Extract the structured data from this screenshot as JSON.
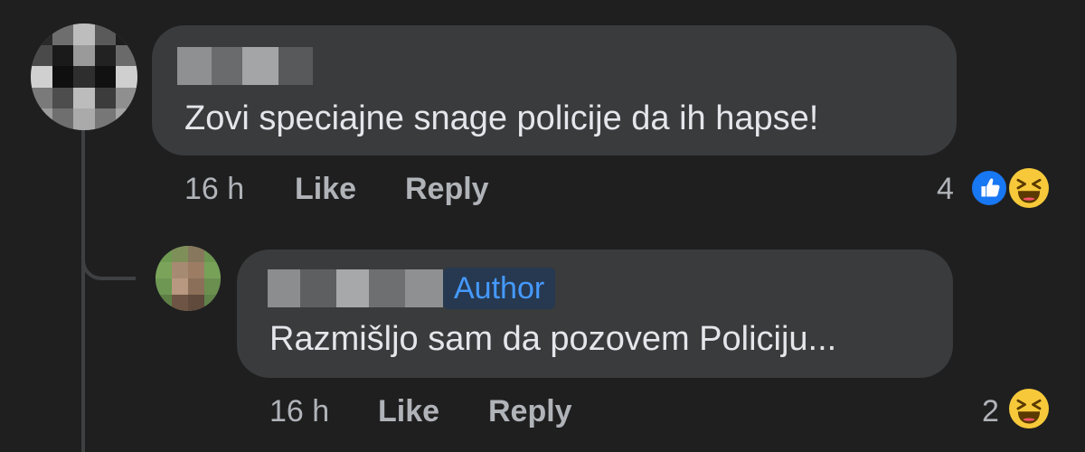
{
  "comments": [
    {
      "text": "Zovi speciajne snage policije da ih hapse!",
      "time": "16 h",
      "like_label": "Like",
      "reply_label": "Reply",
      "reaction_count": "4",
      "reactions": [
        "like-icon",
        "haha-icon"
      ]
    },
    {
      "badge": "Author",
      "text": "Razmišljo sam da pozovem Policiju...",
      "time": "16 h",
      "like_label": "Like",
      "reply_label": "Reply",
      "reaction_count": "2",
      "reactions": [
        "haha-icon"
      ]
    }
  ],
  "colors": {
    "background": "#1f1f20",
    "bubble": "#3a3b3c",
    "text": "#e4e6eb",
    "muted": "#b0b3b8",
    "author_badge_bg": "#263951",
    "author_badge_text": "#4599ff",
    "like_blue": "#1877f2",
    "haha_yellow": "#f7c93a"
  }
}
